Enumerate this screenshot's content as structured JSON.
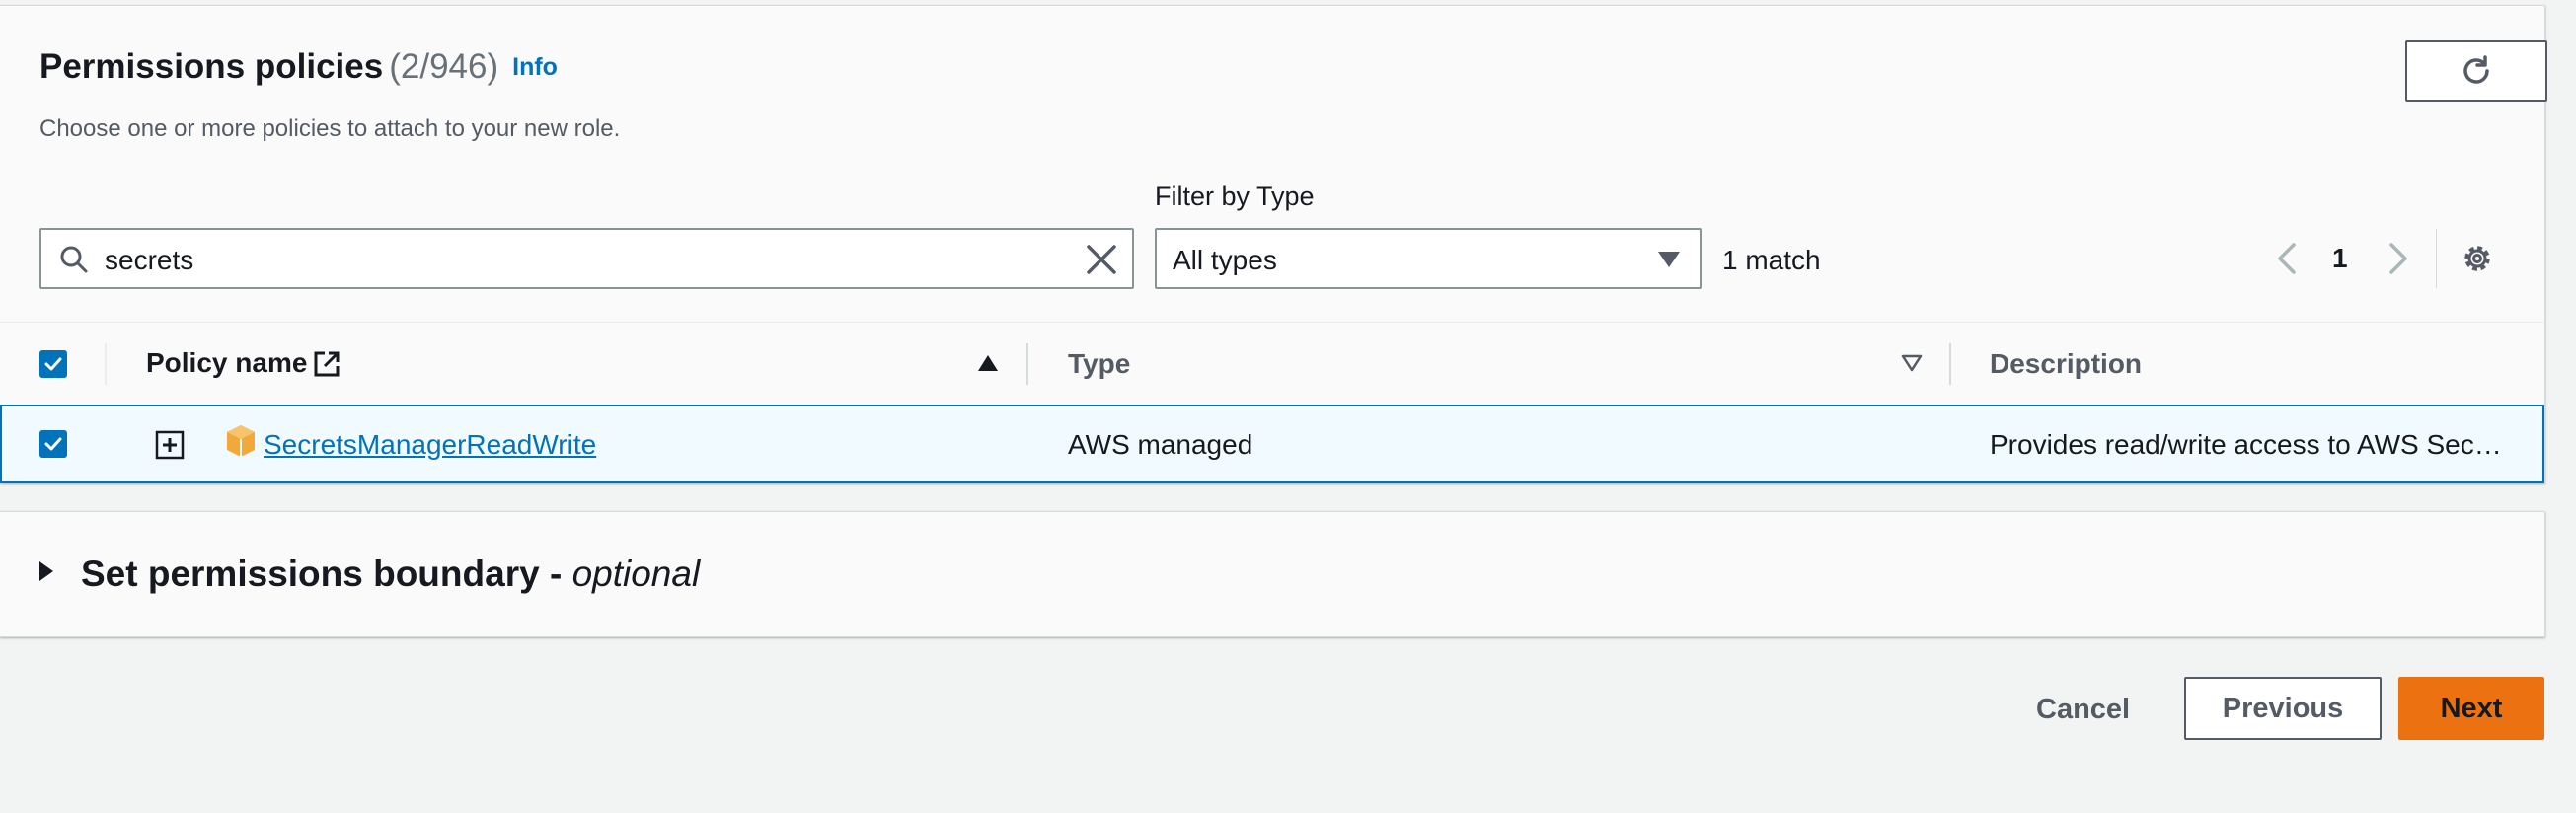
{
  "header": {
    "title": "Permissions policies",
    "count": "(2/946)",
    "info_link": "Info",
    "subtitle": "Choose one or more policies to attach to your new role."
  },
  "toolbar": {
    "search_value": "secrets",
    "filter_label": "Filter by Type",
    "filter_value": "All types",
    "match_text": "1 match",
    "page_number": "1"
  },
  "table": {
    "columns": [
      "Policy name",
      "Type",
      "Description"
    ],
    "rows": [
      {
        "selected": true,
        "policy_name": "SecretsManagerReadWrite",
        "type": "AWS managed",
        "description": "Provides read/write access to AWS Sec…"
      }
    ]
  },
  "boundary": {
    "title": "Set permissions boundary -",
    "optional": "optional"
  },
  "footer": {
    "cancel": "Cancel",
    "previous": "Previous",
    "next": "Next"
  },
  "colors": {
    "primary_action": "#ec7211",
    "link": "#0073bb",
    "selected_row_bg": "#f1faff"
  }
}
